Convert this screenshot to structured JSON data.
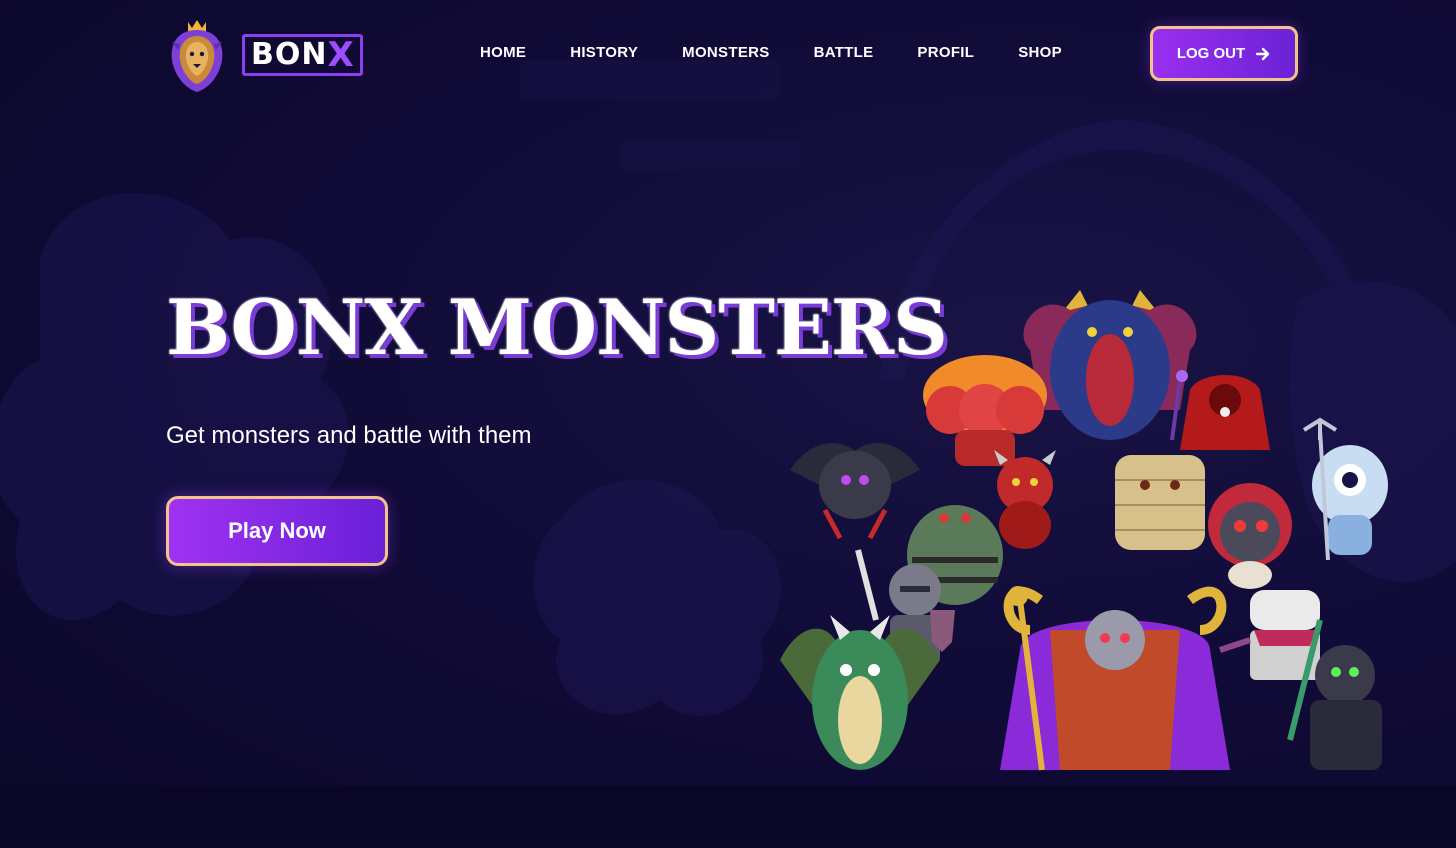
{
  "brand": {
    "name_main": "BON",
    "name_accent": "X"
  },
  "nav": {
    "items": [
      {
        "label": "HOME"
      },
      {
        "label": "HISTORY"
      },
      {
        "label": "MONSTERS"
      },
      {
        "label": "BATTLE"
      },
      {
        "label": "PROFIL"
      },
      {
        "label": "SHOP"
      }
    ]
  },
  "header": {
    "logout_label": "LOG OUT",
    "logout_icon": "arrow-right-icon"
  },
  "hero": {
    "title": "BONX MONSTERS",
    "subtitle": "Get monsters and battle with them",
    "cta_label": "Play Now"
  },
  "theme": {
    "background": "#110b38",
    "accent_purple": "#9a2ff0",
    "button_border": "#f2c48c",
    "title_shadow": "#7b3cd6"
  }
}
